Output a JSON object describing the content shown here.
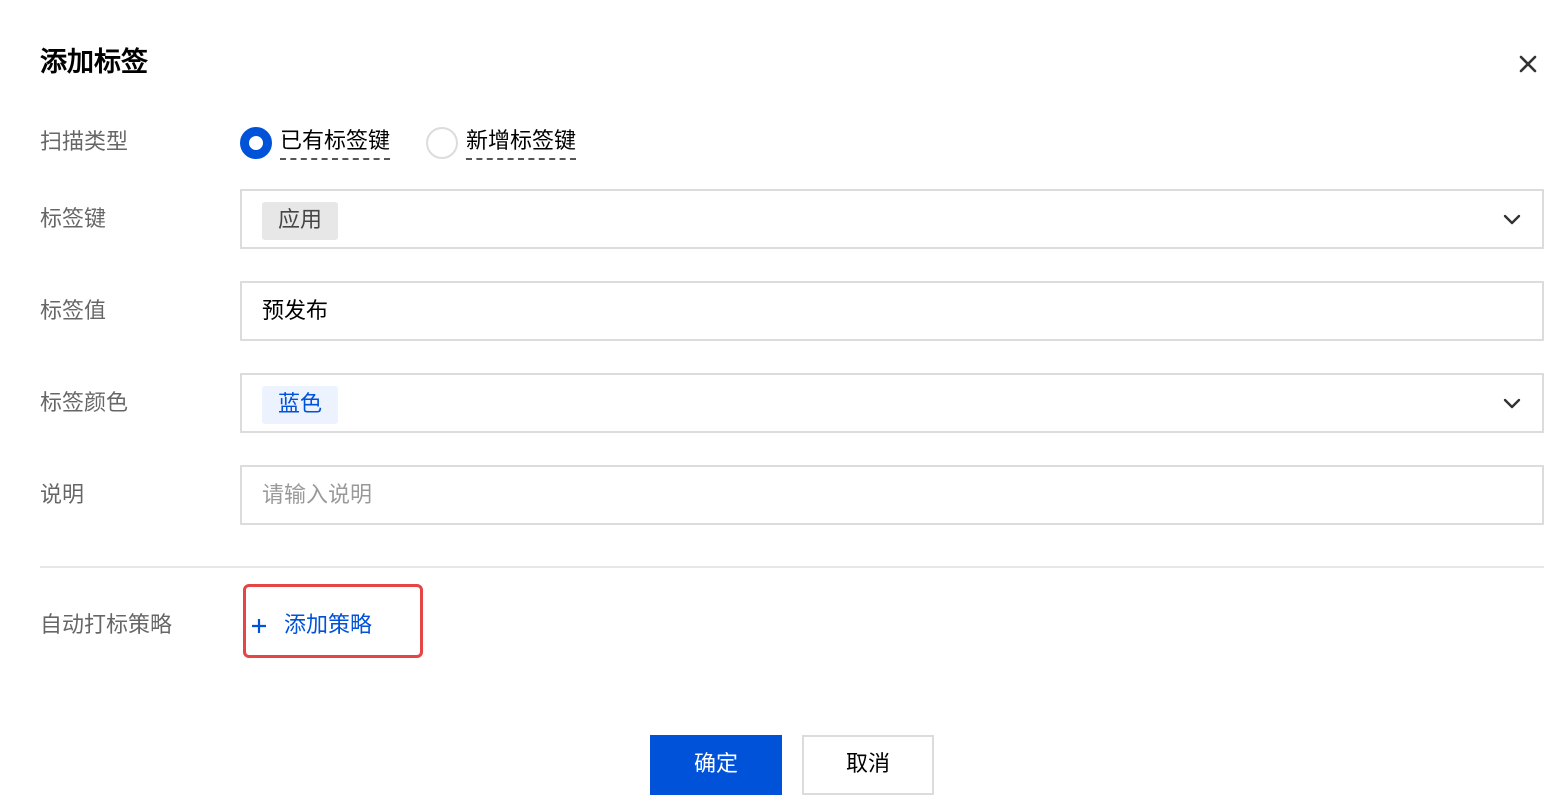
{
  "dialog": {
    "title": "添加标签"
  },
  "form": {
    "scan_type": {
      "label": "扫描类型",
      "options": [
        {
          "label": "已有标签键",
          "checked": true
        },
        {
          "label": "新增标签键",
          "checked": false
        }
      ]
    },
    "tag_key": {
      "label": "标签键",
      "value": "应用"
    },
    "tag_value": {
      "label": "标签值",
      "value": "预发布"
    },
    "tag_color": {
      "label": "标签颜色",
      "value": "蓝色"
    },
    "description": {
      "label": "说明",
      "placeholder": "请输入说明"
    },
    "auto_policy": {
      "label": "自动打标策略",
      "add_label": "添加策略"
    }
  },
  "footer": {
    "confirm_label": "确定",
    "cancel_label": "取消"
  },
  "colors": {
    "primary": "#0052d9",
    "highlight_border": "#e54545"
  }
}
